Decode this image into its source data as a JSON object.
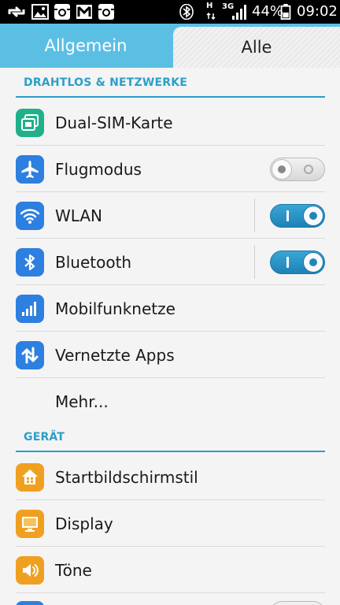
{
  "status_bar": {
    "battery": "44%",
    "time": "09:02",
    "net_h": "H",
    "net_3g": "3G"
  },
  "tabs": {
    "general": "Allgemein",
    "all": "Alle"
  },
  "sections": {
    "wireless": "DRAHTLOS & NETZWERKE",
    "device": "GERÄT"
  },
  "items": {
    "dual_sim": "Dual-SIM-Karte",
    "flight_mode": "Flugmodus",
    "wlan": "WLAN",
    "bluetooth": "Bluetooth",
    "mobile_networks": "Mobilfunknetze",
    "connected_apps": "Vernetzte Apps",
    "more": "Mehr...",
    "home_style": "Startbildschirmstil",
    "display": "Display",
    "sounds": "Töne"
  },
  "toggles": {
    "flight_mode": "off",
    "wlan": "on",
    "bluetooth": "on"
  },
  "colors": {
    "accent": "#2aa0c8",
    "tab_bar": "#5bbfe4",
    "toggle_on": "#1f86bb",
    "icon_blue": "#2d7fe0",
    "icon_green": "#21b08a",
    "icon_orange": "#f0a020"
  }
}
